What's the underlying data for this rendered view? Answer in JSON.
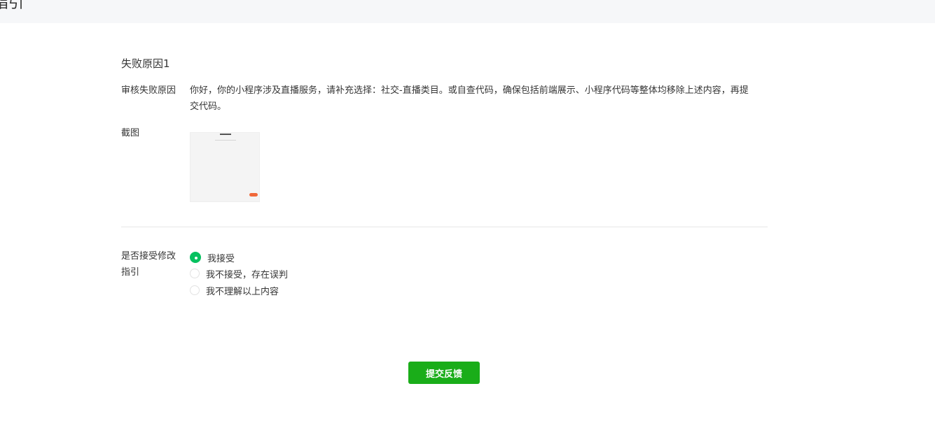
{
  "header": {
    "title": "指引"
  },
  "failure_section": {
    "title": "失败原因1",
    "reason_label": "审核失败原因",
    "reason_text": "你好，你的小程序涉及直播服务，请补充选择：社交-直播类目。或自查代码，确保包括前端展示、小程序代码等整体均移除上述内容，再提交代码。",
    "screenshot_label": "截图"
  },
  "accept_section": {
    "label": "是否接受修改指引",
    "options": [
      {
        "label": "我接受",
        "checked": true
      },
      {
        "label": "我不接受，存在误判",
        "checked": false
      },
      {
        "label": "我不理解以上内容",
        "checked": false
      }
    ]
  },
  "submit": {
    "label": "提交反馈"
  },
  "colors": {
    "accent_green": "#07c160",
    "button_green": "#1aad19",
    "topbar_bg": "#f6f7f9"
  }
}
